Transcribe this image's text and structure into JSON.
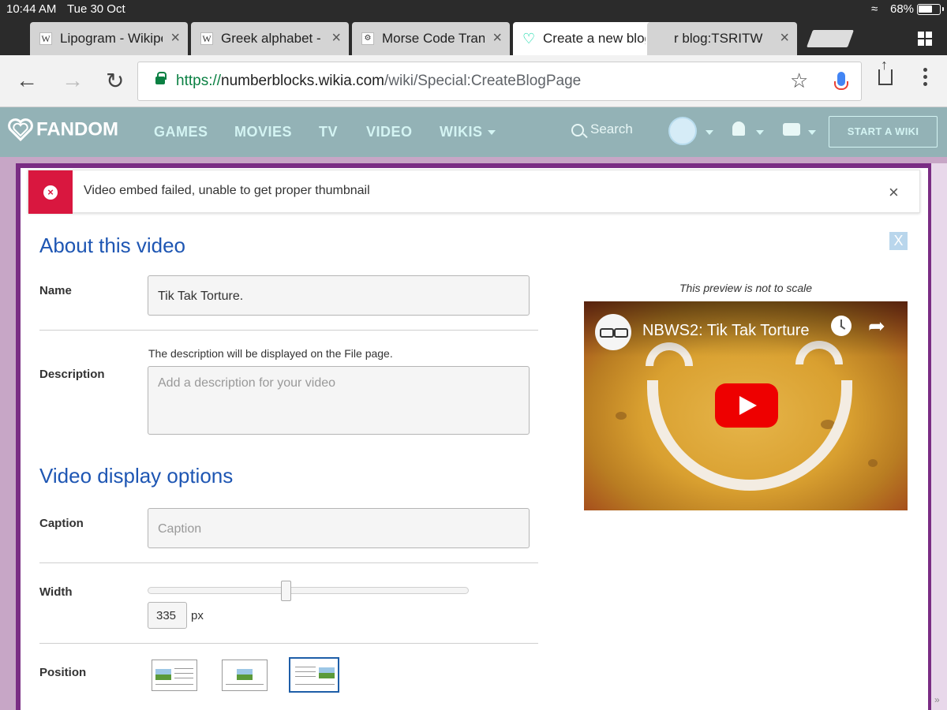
{
  "status_bar": {
    "time": "10:44 AM",
    "date": "Tue 30 Oct",
    "battery": "68%"
  },
  "tabs": [
    {
      "label": "Lipogram - Wikipe",
      "favicon": "W",
      "active": false
    },
    {
      "label": "Greek alphabet -",
      "favicon": "W",
      "active": false
    },
    {
      "label": "Morse Code Tran",
      "favicon": "morse-icon",
      "active": false
    },
    {
      "label": "Create a new blog",
      "favicon": "fandom-heart-icon",
      "active": true
    },
    {
      "label": "r blog:TSRITW",
      "favicon": "",
      "active": false
    }
  ],
  "address_bar": {
    "scheme": "https://",
    "host": "numberblocks.wikia.com",
    "path": "/wiki/Special:CreateBlogPage"
  },
  "fandom_nav": {
    "logo": "FANDOM",
    "links": [
      "GAMES",
      "MOVIES",
      "TV",
      "VIDEO",
      "WIKIS"
    ],
    "search_label": "Search",
    "start_wiki": "START A WIKI"
  },
  "notice": {
    "message": "Video embed failed, unable to get proper thumbnail",
    "accent": "#d9173f"
  },
  "about_section": {
    "title": "About this video",
    "name_label": "Name",
    "name_value": "Tik Tak Torture.",
    "description_hint": "The description will be displayed on the File page.",
    "description_label": "Description",
    "description_placeholder": "Add a description for your video"
  },
  "display_section": {
    "title": "Video display options",
    "caption_label": "Caption",
    "caption_placeholder": "Caption",
    "width_label": "Width",
    "width_value": "335",
    "width_unit": "px",
    "width_slider_fraction": 0.43,
    "position_label": "Position",
    "position_options": [
      "left",
      "center",
      "right"
    ],
    "position_selected": "right"
  },
  "preview": {
    "note": "This preview is not to scale",
    "video_title": "NBWS2: Tik Tak Torture"
  },
  "colors": {
    "link_blue": "#1e56b3",
    "modal_border": "#7a2d84",
    "nav_bg": "#93b2b6"
  }
}
